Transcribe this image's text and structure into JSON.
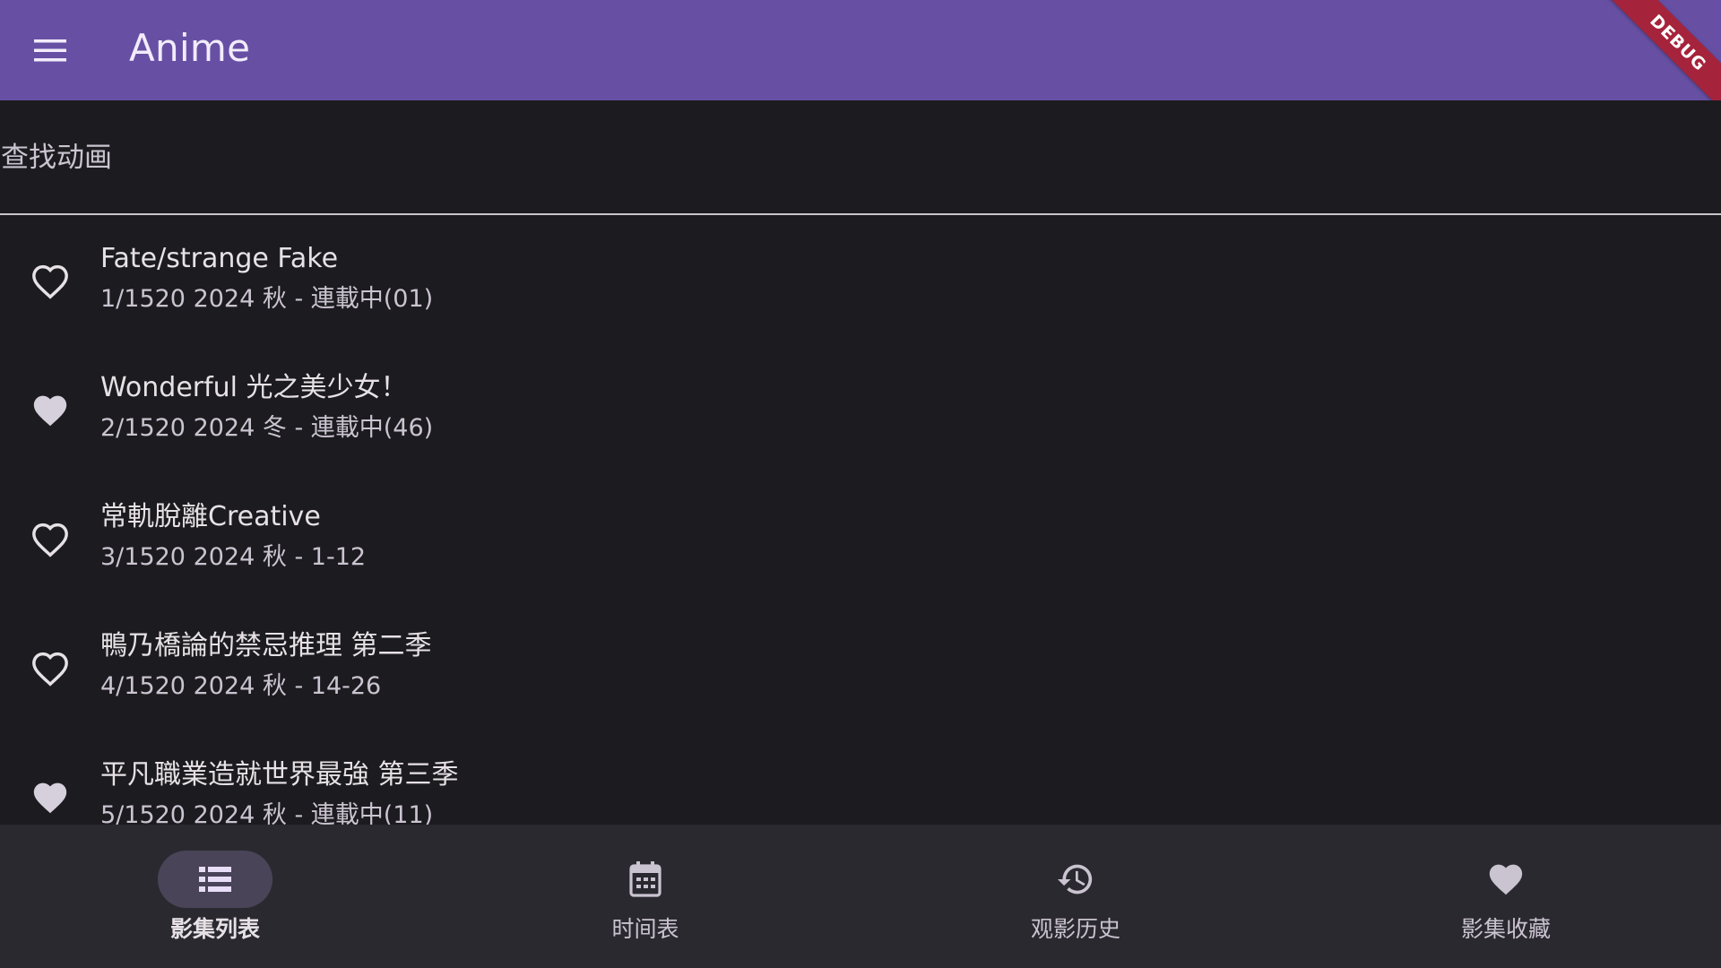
{
  "appbar": {
    "title": "Anime",
    "menu_icon": "menu-icon",
    "debug_banner": "DEBUG",
    "color": "#6750a4"
  },
  "search": {
    "label": "查找动画"
  },
  "anime_list": [
    {
      "title": "Fate/strange Fake",
      "subtitle": "1/1520 2024 秋 - 連載中(01)",
      "favorited": false
    },
    {
      "title": "Wonderful 光之美少女！",
      "subtitle": "2/1520 2024 冬 - 連載中(46)",
      "favorited": true
    },
    {
      "title": "常軌脫離Creative",
      "subtitle": "3/1520 2024 秋 - 1-12",
      "favorited": false
    },
    {
      "title": "鴨乃橋論的禁忌推理 第二季",
      "subtitle": "4/1520 2024 秋 - 14-26",
      "favorited": false
    },
    {
      "title": "平凡職業造就世界最強 第三季",
      "subtitle": "5/1520 2024 秋 - 連載中(11)",
      "favorited": true
    }
  ],
  "bottom_nav": {
    "items": [
      {
        "label": "影集列表",
        "icon": "list-icon",
        "active": true
      },
      {
        "label": "时间表",
        "icon": "calendar-icon",
        "active": false
      },
      {
        "label": "观影历史",
        "icon": "history-icon",
        "active": false
      },
      {
        "label": "影集收藏",
        "icon": "heart-icon",
        "active": false
      }
    ]
  },
  "colors": {
    "background": "#1c1b1f",
    "nav_background": "#2b2930",
    "nav_indicator": "#4a4458",
    "debug": "#a5233b"
  }
}
